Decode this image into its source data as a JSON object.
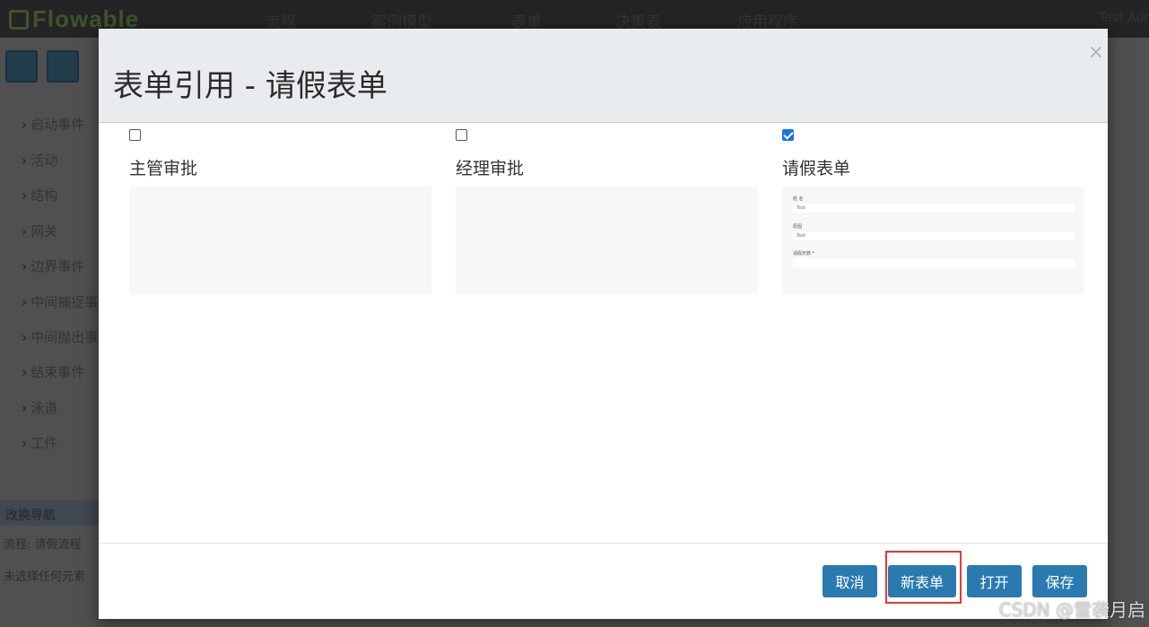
{
  "app": {
    "logo": "Flowable",
    "nav": [
      "流程",
      "案例模型",
      "表单",
      "决策表",
      "应用程序"
    ],
    "user": "Test Adm",
    "palette": [
      "启动事件",
      "活动",
      "结构",
      "网关",
      "边界事件",
      "中间捕捉事",
      "中间抛出事",
      "结束事件",
      "泳道",
      "工件"
    ],
    "minimap_title": "改换导航",
    "process_label": "流程: 请假流程",
    "footer_hint": "未选择任何元素"
  },
  "modal": {
    "title": "表单引用 - 请假表单",
    "close": "×",
    "forms": [
      {
        "name": "主管审批",
        "checked": false
      },
      {
        "name": "经理审批",
        "checked": false
      },
      {
        "name": "请假表单",
        "checked": true
      }
    ],
    "preview": {
      "field1_label": "姓 名",
      "field1_value": "Text",
      "field2_label": "原因",
      "field2_value": "Text",
      "field3_label": "请假天数 *"
    },
    "buttons": {
      "cancel": "取消",
      "new_form": "新表单",
      "open": "打开",
      "save": "保存"
    }
  },
  "watermark": "CSDN @雷袭月启"
}
